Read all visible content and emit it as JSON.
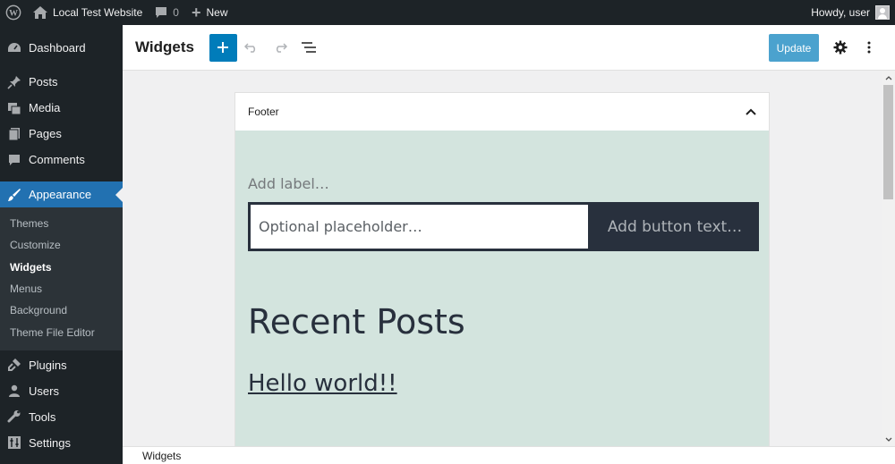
{
  "admin_bar": {
    "site_name": "Local Test Website",
    "comments_count": "0",
    "new_label": "New",
    "greeting": "Howdy, user"
  },
  "sidebar": {
    "items": [
      {
        "label": "Dashboard",
        "icon": "dashboard-icon"
      },
      {
        "label": "Posts",
        "icon": "pin-icon"
      },
      {
        "label": "Media",
        "icon": "media-icon"
      },
      {
        "label": "Pages",
        "icon": "pages-icon"
      },
      {
        "label": "Comments",
        "icon": "comment-icon"
      },
      {
        "label": "Appearance",
        "icon": "brush-icon",
        "current": true
      }
    ],
    "submenu": [
      "Themes",
      "Customize",
      "Widgets",
      "Menus",
      "Background",
      "Theme File Editor"
    ],
    "items_after": [
      {
        "label": "Plugins",
        "icon": "plugin-icon"
      },
      {
        "label": "Users",
        "icon": "users-icon"
      },
      {
        "label": "Tools",
        "icon": "wrench-icon"
      },
      {
        "label": "Settings",
        "icon": "settings-icon"
      }
    ]
  },
  "header": {
    "title": "Widgets",
    "update_label": "Update"
  },
  "widget_area": {
    "title": "Footer",
    "search_label": "Add label…",
    "search_placeholder": "Optional placeholder…",
    "search_button": "Add button text…",
    "recent_posts_title": "Recent Posts",
    "post_link": "Hello world!!"
  },
  "footer_breadcrumb": "Widgets",
  "colors": {
    "admin_bg": "#1d2327",
    "accent": "#2271b1",
    "primary_button": "#007cba",
    "widget_bg": "#d3e4de",
    "theme_text": "#28303d"
  }
}
